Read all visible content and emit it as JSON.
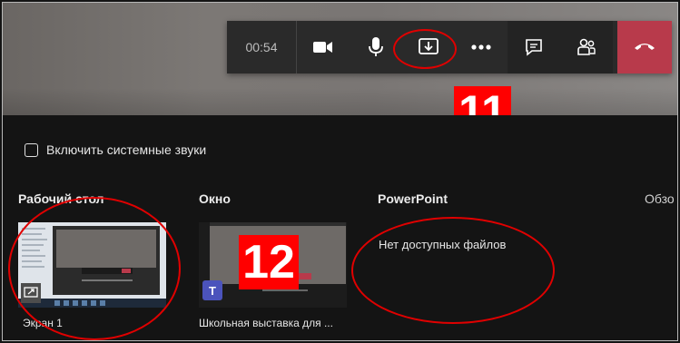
{
  "toolbar": {
    "timer": "00:54",
    "buttons": [
      {
        "id": "camera",
        "icon": "video-camera-icon"
      },
      {
        "id": "mic",
        "icon": "microphone-icon"
      },
      {
        "id": "share",
        "icon": "share-screen-icon"
      },
      {
        "id": "more",
        "icon": "more-options-icon"
      },
      {
        "id": "chat",
        "icon": "chat-icon"
      },
      {
        "id": "participants",
        "icon": "participants-icon"
      },
      {
        "id": "hangup",
        "icon": "hang-up-icon"
      }
    ],
    "hangup_color": "#b83a4b"
  },
  "annotations": {
    "label_11": "11",
    "label_12": "12",
    "color": "#ff0000"
  },
  "share_panel": {
    "system_sound_label": "Включить системные звуки",
    "columns": {
      "desktop": "Рабочий стол",
      "window": "Окно",
      "powerpoint": "PowerPoint",
      "browse": "Обзо"
    },
    "desktop_item_label": "Экран 1",
    "window_item_label": "Школьная выставка для ...",
    "powerpoint_empty": "Нет доступных файлов"
  }
}
